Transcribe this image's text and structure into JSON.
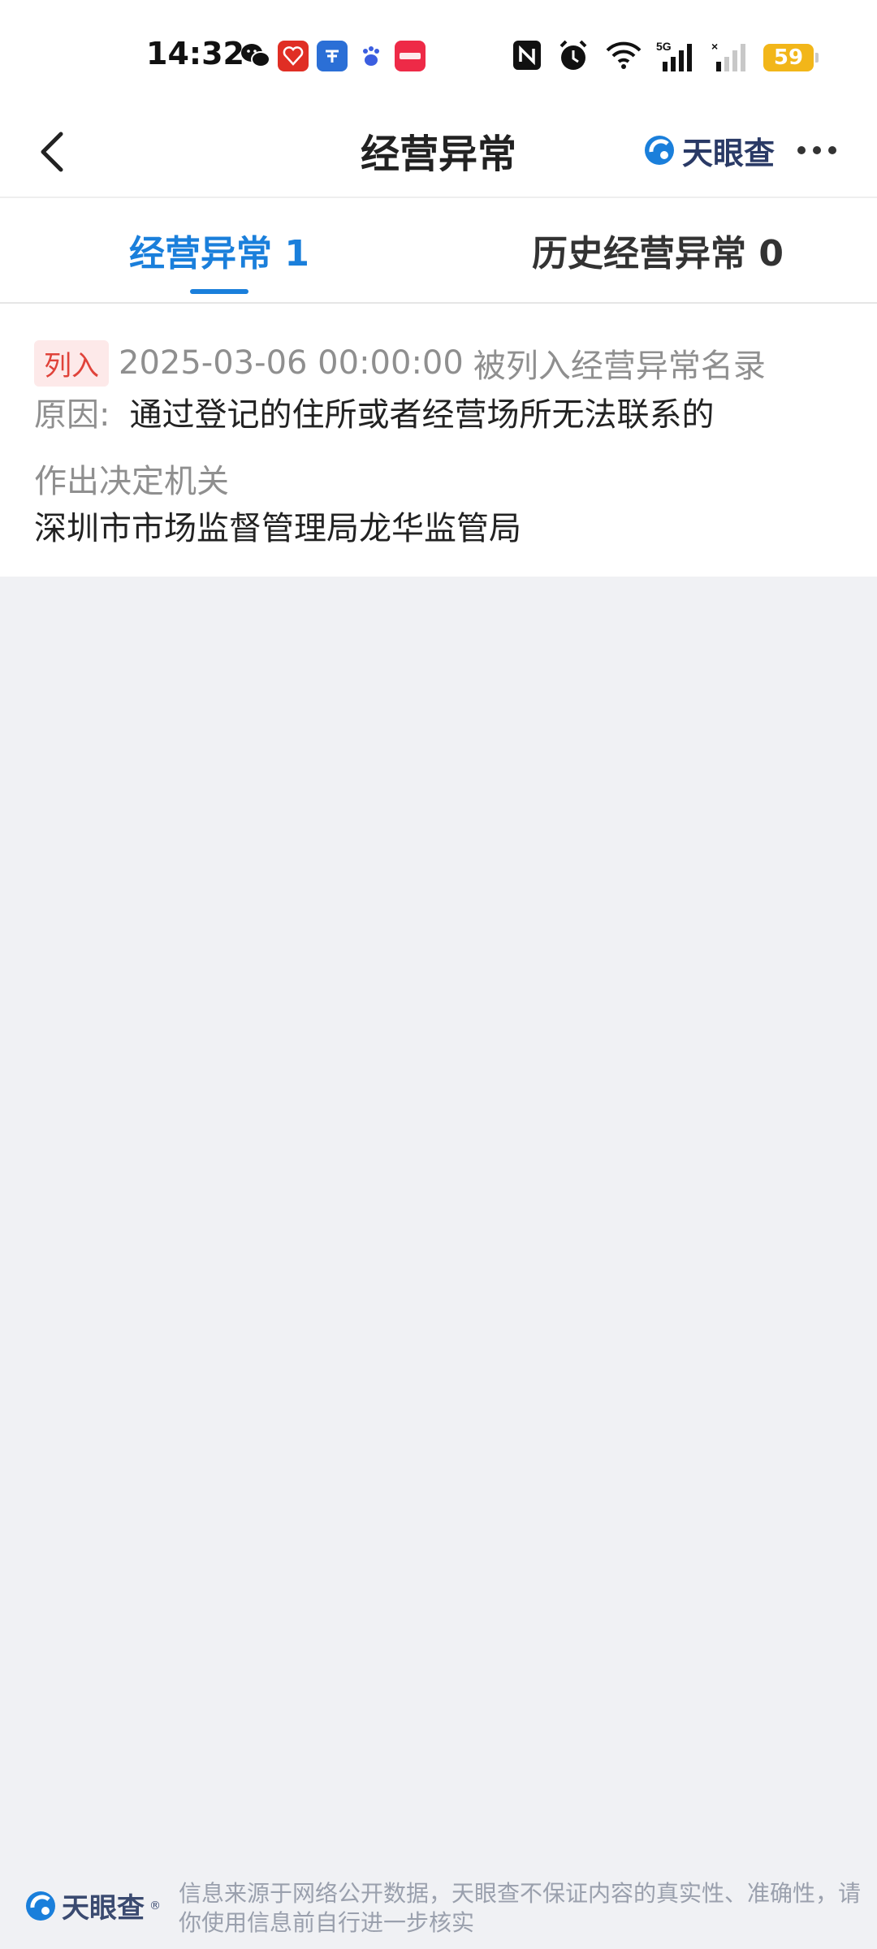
{
  "status_bar": {
    "time": "14:32",
    "battery": "59",
    "network": "5G",
    "notification_icons": [
      "wechat-icon",
      "pinduoduo-icon",
      "jiaoyu-icon",
      "baidu-icon",
      "xiaohongshu-icon"
    ],
    "system_icons": [
      "nfc-icon",
      "alarm-icon",
      "wifi-icon",
      "signal-icon",
      "signal-2-icon",
      "battery-icon"
    ]
  },
  "nav": {
    "title": "经营异常",
    "brand": "天眼查"
  },
  "tabs": [
    {
      "label": "经营异常 1",
      "active": true
    },
    {
      "label": "历史经营异常 0",
      "active": false
    }
  ],
  "record": {
    "tag": "列入",
    "date": "2025-03-06 00:00:00",
    "event": "被列入经营异常名录",
    "reason_label": "原因:",
    "reason": "通过登记的住所或者经营场所无法联系的",
    "authority_label": "作出决定机关",
    "authority": "深圳市市场监督管理局龙华监管局"
  },
  "footer": {
    "brand": "天眼查",
    "disclaimer": "信息来源于网络公开数据，天眼查不保证内容的真实性、准确性，请你使用信息前自行进一步核实"
  },
  "colors": {
    "accent": "#1a7fdb",
    "tag_bg": "#fde9e9",
    "tag_text": "#e0433a",
    "battery": "#f2b619",
    "page_bg": "#f0f1f4"
  }
}
